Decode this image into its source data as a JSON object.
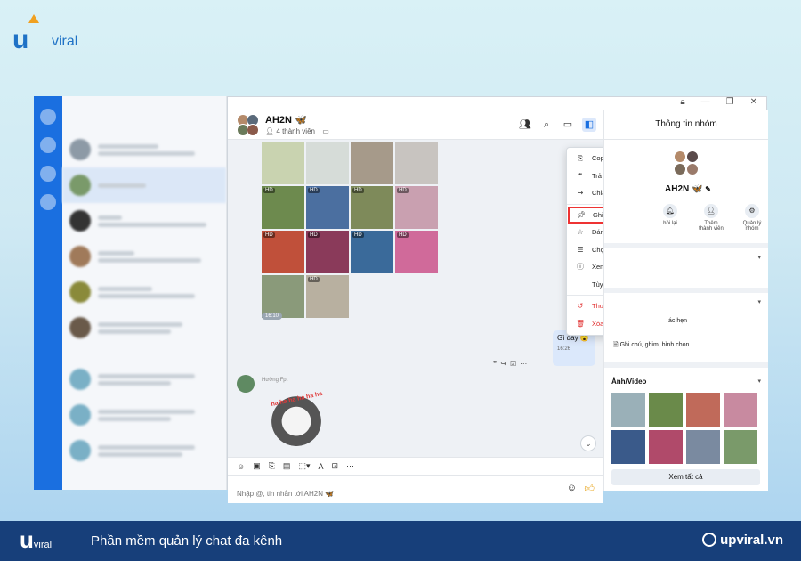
{
  "brand": {
    "logo_top_u": "u",
    "logo_top_viral": "viral",
    "logo_bottom_u": "u",
    "logo_bottom_viral": "viral",
    "tagline": "Phần mềm quản lý chat đa kênh",
    "site": "upviral.vn"
  },
  "chat": {
    "group_name": "AH2N 🦋",
    "member_count": "4 thành viên",
    "photo_time": "16:10",
    "my_message": "Gì đây 😮",
    "my_message_time": "16:26",
    "other_sender": "Hường Fpt",
    "sticker_text": "ha ha ha ha ha ha",
    "composer_placeholder": "Nhập @, tin nhắn tới AH2N 🦋",
    "hd_badge": "HD"
  },
  "context_menu": {
    "items": [
      {
        "label": "Copy tin nhắn",
        "icon": "copy-icon"
      },
      {
        "label": "Trả lời",
        "icon": "reply-icon"
      },
      {
        "label": "Chia sẻ",
        "icon": "share-icon"
      },
      {
        "label": "Ghim tin nhắn",
        "icon": "pin-icon"
      },
      {
        "label": "Đánh dấu tin nhắn",
        "icon": "star-icon"
      },
      {
        "label": "Chọn nhiều tin nhắn",
        "icon": "list-icon"
      },
      {
        "label": "Xem chi tiết",
        "icon": "info-icon"
      },
      {
        "label": "Tùy chọn khác",
        "icon": ""
      },
      {
        "label": "Thu hồi",
        "icon": "undo-icon"
      },
      {
        "label": "Xóa chỉ ở phía tôi",
        "icon": "trash-icon"
      }
    ]
  },
  "info_panel": {
    "title": "Thông tin nhóm",
    "group_name": "AH2N 🦋",
    "actions": [
      {
        "label": "hồi lại"
      },
      {
        "label": "Thêm thành viên"
      },
      {
        "label": "Quản lý nhóm"
      }
    ],
    "rows": {
      "reminder": "ác hẹn",
      "notes": "Ghi chú, ghim, bình chọn"
    },
    "media_title": "Ảnh/Video",
    "see_all": "Xem tất cả"
  },
  "colors": {
    "accent": "#1a6fe0",
    "highlight": "#e33333",
    "brand_bar": "#173f7a"
  }
}
